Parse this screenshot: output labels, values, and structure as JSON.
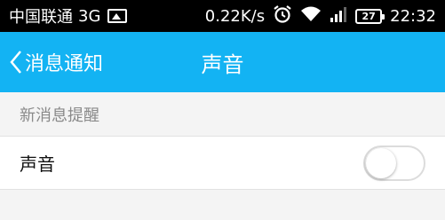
{
  "status_bar": {
    "carrier": "中国联通",
    "network": "3G",
    "speed": "0.22K/s",
    "battery": "27",
    "time": "22:32"
  },
  "nav": {
    "back_label": "消息通知",
    "title": "声音"
  },
  "section": {
    "header": "新消息提醒"
  },
  "settings": {
    "sound_label": "声音",
    "sound_enabled": false
  },
  "colors": {
    "nav_background": "#13b3f3",
    "status_background": "#000000",
    "page_background": "#f4f4f4"
  }
}
